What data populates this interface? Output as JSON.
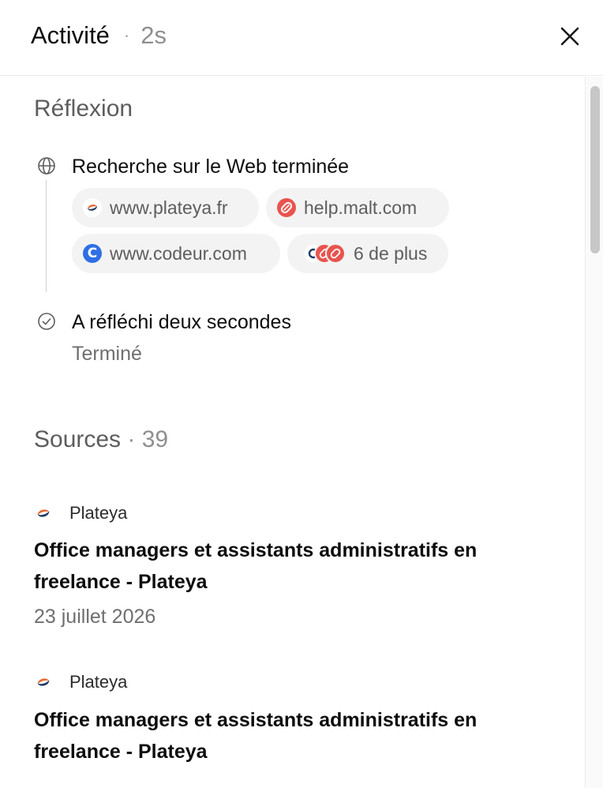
{
  "header": {
    "title": "Activité",
    "separator": "·",
    "duration": "2s"
  },
  "reflection": {
    "title": "Réflexion",
    "search_step": {
      "label": "Recherche sur le Web terminée",
      "chips": [
        {
          "label": "www.plateya.fr",
          "icon": "plateya-favicon"
        },
        {
          "label": "help.malt.com",
          "icon": "malt-favicon"
        },
        {
          "label": "www.codeur.com",
          "icon": "codeur-favicon",
          "icon_letter": "C"
        },
        {
          "label": "6 de plus",
          "icon": "stacked-favicons"
        }
      ]
    },
    "think_step": {
      "label": "A réfléchi deux secondes",
      "status": "Terminé"
    }
  },
  "sources": {
    "title": "Sources",
    "separator": "·",
    "count": "39",
    "items": [
      {
        "site": "Plateya",
        "title": "Office managers et assistants administratifs en freelance - Plateya",
        "date": "23 juillet 2026"
      },
      {
        "site": "Plateya",
        "title": "Office managers et assistants administratifs en freelance - Plateya",
        "date": ""
      }
    ]
  },
  "colors": {
    "malt": "#e8544f",
    "codeur": "#2f6fe4",
    "plateya_navy": "#1f3a63",
    "plateya_orange": "#e8642c"
  }
}
